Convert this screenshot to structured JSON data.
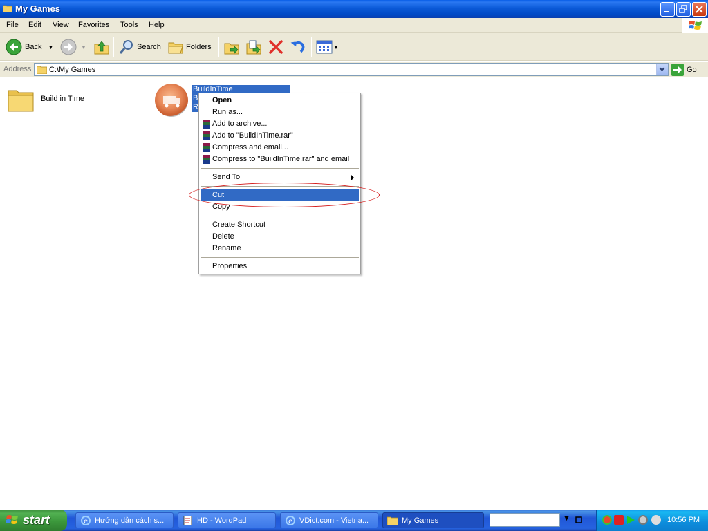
{
  "window": {
    "title": "My Games"
  },
  "menubar": {
    "items": [
      "File",
      "Edit",
      "View",
      "Favorites",
      "Tools",
      "Help"
    ]
  },
  "toolbar": {
    "back_label": "Back",
    "search_label": "Search",
    "folders_label": "Folders"
  },
  "address": {
    "label": "Address",
    "value": "C:\\My Games",
    "go_label": "Go"
  },
  "content": {
    "folder_name": "Build in Time",
    "selected_file_lines": [
      "BuildInTime",
      "Bu",
      "Re"
    ]
  },
  "context_menu": {
    "items": [
      {
        "label": "Open",
        "bold": true
      },
      {
        "label": "Run as..."
      },
      {
        "label": "Add to archive...",
        "icon": "winrar-icon"
      },
      {
        "label": "Add to \"BuildInTime.rar\"",
        "icon": "winrar-icon"
      },
      {
        "label": "Compress and email...",
        "icon": "winrar-icon"
      },
      {
        "label": "Compress to \"BuildInTime.rar\" and email",
        "icon": "winrar-icon"
      },
      {
        "label": "Send To",
        "submenu": true
      },
      {
        "label": "Cut",
        "highlighted": true
      },
      {
        "label": "Copy"
      },
      {
        "label": "Create Shortcut"
      },
      {
        "label": "Delete"
      },
      {
        "label": "Rename"
      },
      {
        "label": "Properties"
      }
    ]
  },
  "taskbar": {
    "start_label": "start",
    "tasks": [
      {
        "label": "Hướng dẫn cách s...",
        "icon": "ie-icon"
      },
      {
        "label": "HD - WordPad",
        "icon": "wordpad-icon"
      },
      {
        "label": "VDict.com - Vietna...",
        "icon": "ie-icon"
      },
      {
        "label": "My Games",
        "icon": "folder-icon",
        "active": true
      }
    ],
    "clock": "10:56 PM"
  },
  "colors": {
    "selection": "#316ac5",
    "annotation": "#d41a1a",
    "titlebar": "#0b5ad8"
  }
}
